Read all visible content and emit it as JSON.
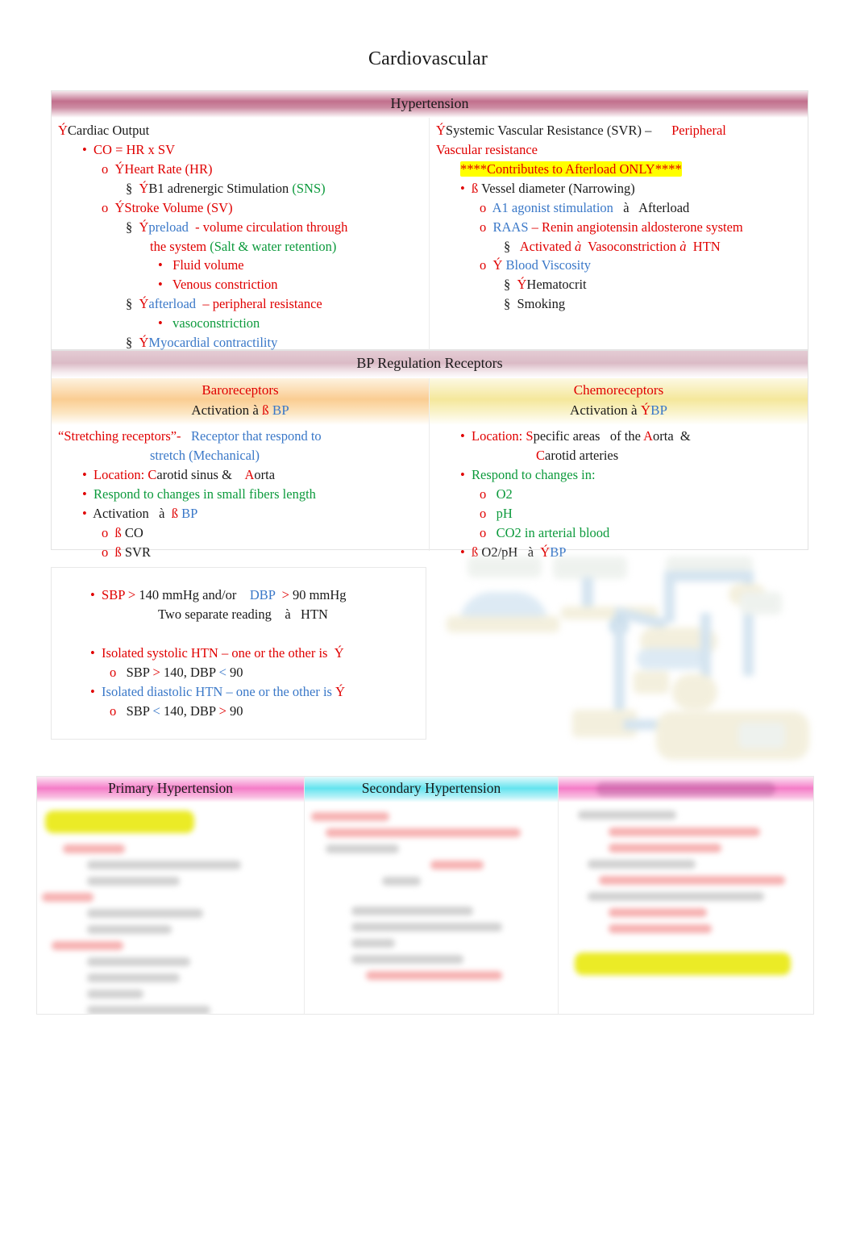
{
  "document": {
    "title": "Cardiovascular"
  },
  "hypertension": {
    "band_label": "Hypertension",
    "left": {
      "lines": [
        {
          "indent": 0,
          "marker": "",
          "segs": [
            {
              "t": "Ý",
              "c": "red"
            },
            {
              "t": "Cardiac Output",
              "c": "black"
            }
          ]
        },
        {
          "indent": 1,
          "marker": "•",
          "segs": [
            {
              "t": "  CO = HR x SV",
              "c": "red"
            }
          ]
        },
        {
          "indent": 2,
          "marker": "o",
          "segs": [
            {
              "t": "  ÝHeart Rate (HR)",
              "c": "red"
            }
          ]
        },
        {
          "indent": 3,
          "marker": "§",
          "segs": [
            {
              "t": "  Ý",
              "c": "red"
            },
            {
              "t": "B1 adrenergic Stimulation ",
              "c": "black"
            },
            {
              "t": "(SNS)",
              "c": "green"
            }
          ]
        },
        {
          "indent": 2,
          "marker": "o",
          "segs": [
            {
              "t": "  ÝStroke Volume (SV)",
              "c": "red"
            }
          ]
        },
        {
          "indent": 3,
          "marker": "§",
          "segs": [
            {
              "t": "  Ý",
              "c": "red"
            },
            {
              "t": "preload",
              "c": "blue"
            },
            {
              "t": "  - volume circulation through",
              "c": "red"
            }
          ]
        },
        {
          "indent": 0,
          "pad": "l3h",
          "marker": "",
          "segs": [
            {
              "t": "the system ",
              "c": "red"
            },
            {
              "t": "(Salt & water retention)",
              "c": "green"
            }
          ]
        },
        {
          "indent": 4,
          "marker": "•",
          "segs": [
            {
              "t": "   Fluid volume",
              "c": "red"
            }
          ]
        },
        {
          "indent": 4,
          "marker": "•",
          "segs": [
            {
              "t": "   Venous constriction",
              "c": "red"
            }
          ]
        },
        {
          "indent": 3,
          "marker": "§",
          "segs": [
            {
              "t": "  Ý",
              "c": "red"
            },
            {
              "t": "afterload",
              "c": "blue"
            },
            {
              "t": "  – peripheral resistance",
              "c": "red"
            }
          ]
        },
        {
          "indent": 4,
          "marker": "•",
          "segs": [
            {
              "t": "   vasoconstriction",
              "c": "green"
            }
          ]
        },
        {
          "indent": 3,
          "marker": "§",
          "segs": [
            {
              "t": "  Ý",
              "c": "red"
            },
            {
              "t": "Myocardial contractility",
              "c": "blue"
            }
          ]
        }
      ]
    },
    "right": {
      "lines": [
        {
          "indent": 0,
          "marker": "",
          "segs": [
            {
              "t": "Ý",
              "c": "red"
            },
            {
              "t": "Systemic Vascular Resistance (SVR) – ",
              "c": "black"
            },
            {
              "t": "     Peripheral",
              "c": "red"
            }
          ]
        },
        {
          "indent": 0,
          "marker": "",
          "segs": [
            {
              "t": "Vascular resistance",
              "c": "red"
            }
          ]
        },
        {
          "indent": 1,
          "marker": "",
          "segs": [
            {
              "t": "****Contributes to Afterload ONLY****",
              "c": "red",
              "hl": true
            }
          ]
        },
        {
          "indent": 1,
          "marker": "•",
          "segs": [
            {
              "t": "  ß",
              "c": "red"
            },
            {
              "t": " Vessel diameter (Narrowing)",
              "c": "black"
            }
          ]
        },
        {
          "indent": 2,
          "marker": "o",
          "segs": [
            {
              "t": "  A1 agonist stimulation",
              "c": "blue"
            },
            {
              "t": "   à   Afterload",
              "c": "black"
            }
          ]
        },
        {
          "indent": 2,
          "marker": "o",
          "segs": [
            {
              "t": "  RAAS ",
              "c": "blue"
            },
            {
              "t": "– Renin angiotensin aldosterone system",
              "c": "red"
            }
          ]
        },
        {
          "indent": 3,
          "marker": "§",
          "segs": [
            {
              "t": "   Activated ",
              "c": "red"
            },
            {
              "t": "à",
              "c": "red",
              "i": true
            },
            {
              "t": "  Vasoconstriction ",
              "c": "red"
            },
            {
              "t": "à",
              "c": "red",
              "i": true
            },
            {
              "t": "  HTN",
              "c": "red"
            }
          ]
        },
        {
          "indent": 2,
          "marker": "o",
          "segs": [
            {
              "t": "  Ý",
              "c": "red"
            },
            {
              "t": " Blood Viscosity",
              "c": "blue"
            }
          ]
        },
        {
          "indent": 3,
          "marker": "§",
          "segs": [
            {
              "t": "  Ý",
              "c": "red"
            },
            {
              "t": "Hematocrit",
              "c": "black"
            }
          ]
        },
        {
          "indent": 3,
          "marker": "§",
          "segs": [
            {
              "t": "  Smoking",
              "c": "black"
            }
          ]
        }
      ]
    }
  },
  "bp_regulation": {
    "band_label": "BP Regulation Receptors",
    "baroreceptors": {
      "title": "Baroreceptors",
      "subtitle_segs": [
        {
          "t": "Activation   à  ",
          "c": "black"
        },
        {
          "t": "ß",
          "c": "red"
        },
        {
          "t": " BP",
          "c": "blue"
        }
      ],
      "lines": [
        {
          "indent": 0,
          "marker": "",
          "segs": [
            {
              "t": "“Stretching receptors”-",
              "c": "red"
            },
            {
              "t": "   Receptor that respond to",
              "c": "blue"
            }
          ]
        },
        {
          "indent": 0,
          "pad": "l3h",
          "marker": "",
          "segs": [
            {
              "t": "stretch (Mechanical)",
              "c": "blue"
            }
          ]
        },
        {
          "indent": 1,
          "marker": "•",
          "segs": [
            {
              "t": "  Location: ",
              "c": "red"
            },
            {
              "t": "C",
              "c": "red"
            },
            {
              "t": "arotid sinus &    ",
              "c": "black"
            },
            {
              "t": "A",
              "c": "red"
            },
            {
              "t": "orta",
              "c": "black"
            }
          ]
        },
        {
          "indent": 1,
          "marker": "•",
          "segs": [
            {
              "t": "  Respond to changes in small fibers length",
              "c": "green"
            }
          ]
        },
        {
          "indent": 1,
          "marker": "•",
          "segs": [
            {
              "t": "  Activation   à  ",
              "c": "black"
            },
            {
              "t": "ß",
              "c": "red"
            },
            {
              "t": " BP",
              "c": "blue"
            }
          ]
        },
        {
          "indent": 2,
          "marker": "o",
          "segs": [
            {
              "t": "  ß",
              "c": "red"
            },
            {
              "t": " CO",
              "c": "black"
            }
          ]
        },
        {
          "indent": 2,
          "marker": "o",
          "segs": [
            {
              "t": "  ß",
              "c": "red"
            },
            {
              "t": " SVR",
              "c": "black"
            }
          ]
        }
      ]
    },
    "chemoreceptors": {
      "title": "Chemoreceptors",
      "subtitle_segs": [
        {
          "t": "Activation   à  ",
          "c": "black"
        },
        {
          "t": "Ý",
          "c": "red"
        },
        {
          "t": "BP",
          "c": "blue"
        }
      ],
      "lines": [
        {
          "indent": 1,
          "marker": "•",
          "segs": [
            {
              "t": "  Location: ",
              "c": "red"
            },
            {
              "t": "S",
              "c": "red"
            },
            {
              "t": "pecific areas ",
              "c": "black"
            },
            {
              "t": "  of the ",
              "c": "black"
            },
            {
              "t": "A",
              "c": "red"
            },
            {
              "t": "orta  &",
              "c": "black"
            }
          ]
        },
        {
          "indent": 0,
          "pad": "l4",
          "marker": "",
          "segs": [
            {
              "t": "C",
              "c": "red"
            },
            {
              "t": "arotid arteries",
              "c": "black"
            }
          ]
        },
        {
          "indent": 1,
          "marker": "•",
          "segs": [
            {
              "t": "  Respond to changes in:",
              "c": "green"
            }
          ]
        },
        {
          "indent": 2,
          "marker": "o",
          "segs": [
            {
              "t": "   O2",
              "c": "green"
            }
          ]
        },
        {
          "indent": 2,
          "marker": "o",
          "segs": [
            {
              "t": "   pH",
              "c": "green"
            }
          ]
        },
        {
          "indent": 2,
          "marker": "o",
          "segs": [
            {
              "t": "   CO2 in arterial blood",
              "c": "green"
            }
          ]
        },
        {
          "indent": 1,
          "marker": "•",
          "segs": [
            {
              "t": "  ß",
              "c": "red"
            },
            {
              "t": " O2/pH   à  ",
              "c": "black"
            },
            {
              "t": "Ý",
              "c": "red"
            },
            {
              "t": "BP",
              "c": "blue"
            }
          ]
        }
      ]
    }
  },
  "bp_criteria": {
    "lines": [
      {
        "indent": 1,
        "marker": "•",
        "segs": [
          {
            "t": "  SBP ",
            "c": "red"
          },
          {
            "t": "> ",
            "c": "red"
          },
          {
            "t": "140 mmHg and/or    ",
            "c": "black"
          },
          {
            "t": "DBP ",
            "c": "blue"
          },
          {
            "t": " > ",
            "c": "red"
          },
          {
            "t": "90 mmHg",
            "c": "black"
          }
        ]
      },
      {
        "indent": 0,
        "pad": "l3h",
        "marker": "",
        "segs": [
          {
            "t": "Two separate reading    à   HTN",
            "c": "black"
          }
        ]
      },
      {
        "indent": 0,
        "marker": "",
        "segs": [
          {
            "t": " ",
            "c": "black"
          }
        ]
      },
      {
        "indent": 1,
        "marker": "•",
        "segs": [
          {
            "t": "  Isolated systolic HTN – one or the other is  ",
            "c": "red"
          },
          {
            "t": "Ý",
            "c": "red"
          }
        ]
      },
      {
        "indent": 2,
        "marker": "o",
        "segs": [
          {
            "t": "   SBP ",
            "c": "black"
          },
          {
            "t": "> ",
            "c": "red"
          },
          {
            "t": "140, DBP ",
            "c": "black"
          },
          {
            "t": "< ",
            "c": "blue"
          },
          {
            "t": "90",
            "c": "black"
          }
        ]
      },
      {
        "indent": 1,
        "marker": "•",
        "segs": [
          {
            "t": "  Isolated diastolic HTN – one or the other is ",
            "c": "blue"
          },
          {
            "t": "Ý",
            "c": "red"
          }
        ]
      },
      {
        "indent": 2,
        "marker": "o",
        "segs": [
          {
            "t": "   SBP ",
            "c": "black"
          },
          {
            "t": "< ",
            "c": "blue"
          },
          {
            "t": "140, DBP ",
            "c": "black"
          },
          {
            "t": "> ",
            "c": "red"
          },
          {
            "t": "90",
            "c": "black"
          }
        ]
      }
    ]
  },
  "bottom_sections": {
    "columns": [
      {
        "header": "Primary Hypertension",
        "header_style": "head-pink",
        "redacted": true
      },
      {
        "header": "Secondary Hypertension",
        "header_style": "head-cyan",
        "redacted": true
      },
      {
        "header": "",
        "header_style": "head-pink head-redacted",
        "redacted": true
      }
    ]
  },
  "colors": {
    "red": "#e00000",
    "blue": "#3a78c8",
    "green": "#0c9a3c",
    "highlight_yellow": "#ffff00",
    "band_hypertension": "#be6887",
    "band_bp_regulation": "#cda0b0",
    "baro_band": "#facA8c",
    "chemo_band": "#f4e696",
    "primary_header": "#f476c5",
    "secondary_header": "#5ce2ee"
  }
}
